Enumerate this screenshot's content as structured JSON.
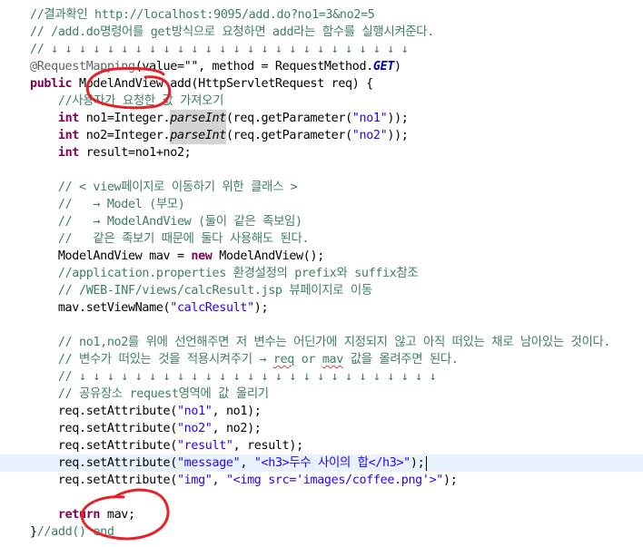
{
  "editor": {
    "code_lines": [
      [
        [
          "c",
          "//결과확인 http://localhost:9095/add.do?no1=3&no2=5"
        ]
      ],
      [
        [
          "c",
          "// /add.do명령어를 get방식으로 요청하면 add라는 함수를 실행시켜준다."
        ]
      ],
      [
        [
          "c",
          "// ↓ ↓ ↓ ↓ ↓ ↓ ↓ ↓ ↓ ↓ ↓ ↓ ↓ ↓ ↓ ↓ ↓ ↓ ↓ ↓ ↓ ↓ ↓ ↓ ↓ ↓"
        ]
      ],
      [
        [
          "ann",
          "@RequestMapping"
        ],
        [
          "",
          "(value=\"\", method = RequestMethod."
        ],
        [
          "pd",
          "GET"
        ],
        [
          "",
          ")"
        ]
      ],
      [
        [
          "kw",
          "public"
        ],
        [
          "",
          " ModelAndView add(HttpServletRequest req) {"
        ]
      ],
      [
        [
          "",
          "    "
        ],
        [
          "c",
          "//사용자가 요청한 값 가져오기"
        ]
      ],
      [
        [
          "",
          "    "
        ],
        [
          "kw",
          "int"
        ],
        [
          "",
          " no1=Integer."
        ],
        [
          "ital hl",
          "parseInt"
        ],
        [
          "",
          "(req.getParameter("
        ],
        [
          "str",
          "\"no1\""
        ],
        [
          "",
          "));"
        ]
      ],
      [
        [
          "",
          "    "
        ],
        [
          "kw",
          "int"
        ],
        [
          "",
          " no2=Integer."
        ],
        [
          "ital hl",
          "parseInt"
        ],
        [
          "",
          "(req.getParameter("
        ],
        [
          "str",
          "\"no2\""
        ],
        [
          "",
          "));"
        ]
      ],
      [
        [
          "",
          "    "
        ],
        [
          "kw",
          "int"
        ],
        [
          "",
          " result=no1+no2;"
        ]
      ],
      [],
      [
        [
          "",
          "    "
        ],
        [
          "c",
          "// < view페이지로 이동하기 위한 클래스 >"
        ]
      ],
      [
        [
          "",
          "    "
        ],
        [
          "c",
          "//   → Model (부모)"
        ]
      ],
      [
        [
          "",
          "    "
        ],
        [
          "c",
          "//   → ModelAndView (둘이 같은 족보임)"
        ]
      ],
      [
        [
          "",
          "    "
        ],
        [
          "c",
          "//   같은 족보기 때문에 둘다 사용해도 된다."
        ]
      ],
      [
        [
          "",
          "    ModelAndView mav = "
        ],
        [
          "kw",
          "new"
        ],
        [
          "",
          " ModelAndView();"
        ]
      ],
      [
        [
          "",
          "    "
        ],
        [
          "c",
          "//application.properties 환경설정의 prefix와 suffix참조"
        ]
      ],
      [
        [
          "",
          "    "
        ],
        [
          "c",
          "// /WEB-INF/views/calcResult.jsp 뷰페이지로 이동"
        ]
      ],
      [
        [
          "",
          "    mav.setViewName("
        ],
        [
          "str",
          "\"calcResult\""
        ],
        [
          "",
          ");"
        ]
      ],
      [],
      [
        [
          "",
          "    "
        ],
        [
          "c",
          "// no1,no2를 위에 선언해주면 저 변수는 어딘가에 지정되지 않고 아직 떠있는 채로 남아있는 것이다."
        ]
      ],
      [
        [
          "",
          "    "
        ],
        [
          "c",
          "// 변수가 떠있는 것을 적용시켜주기 → "
        ],
        [
          "c sq",
          "req"
        ],
        [
          "c",
          " or "
        ],
        [
          "c sq",
          "mav"
        ],
        [
          "c",
          " 값을 올려주면 된다."
        ]
      ],
      [
        [
          "",
          "    "
        ],
        [
          "c",
          "// ↓ ↓ ↓ ↓ ↓ ↓ ↓ ↓ ↓ ↓ ↓ ↓ ↓ ↓ ↓ ↓ ↓ ↓ ↓ ↓ ↓ ↓ ↓ ↓ ↓ ↓"
        ]
      ],
      [
        [
          "",
          "    "
        ],
        [
          "c",
          "// 공유장소 request영역에 값 올리기"
        ]
      ],
      [
        [
          "",
          "    req.setAttribute("
        ],
        [
          "str",
          "\"no1\""
        ],
        [
          "",
          ", no1);"
        ]
      ],
      [
        [
          "",
          "    req.setAttribute("
        ],
        [
          "str",
          "\"no2\""
        ],
        [
          "",
          ", no2);"
        ]
      ],
      [
        [
          "",
          "    req.setAttribute("
        ],
        [
          "str",
          "\"result\""
        ],
        [
          "",
          ", result);"
        ]
      ],
      [
        [
          "",
          "    req.setAttribute("
        ],
        [
          "str",
          "\"message\""
        ],
        [
          "",
          ", "
        ],
        [
          "str",
          "\"<h3>두수 사이의 합</h3>\""
        ],
        [
          "",
          ");"
        ]
      ],
      [
        [
          "",
          "    req.setAttribute("
        ],
        [
          "str",
          "\"img\""
        ],
        [
          "",
          ", "
        ],
        [
          "str",
          "\"<img src='images/coffee.png'>\""
        ],
        [
          "",
          ");"
        ]
      ],
      [],
      [
        [
          "",
          "    "
        ],
        [
          "kw",
          "return"
        ],
        [
          "",
          " mav;"
        ]
      ],
      [
        [
          "",
          "}"
        ],
        [
          "c",
          "//add() end"
        ]
      ]
    ],
    "current_line": 26
  },
  "annotations": {
    "marker_color": "#e8202a",
    "circled": [
      "ModelAndView",
      "return mav;"
    ]
  }
}
